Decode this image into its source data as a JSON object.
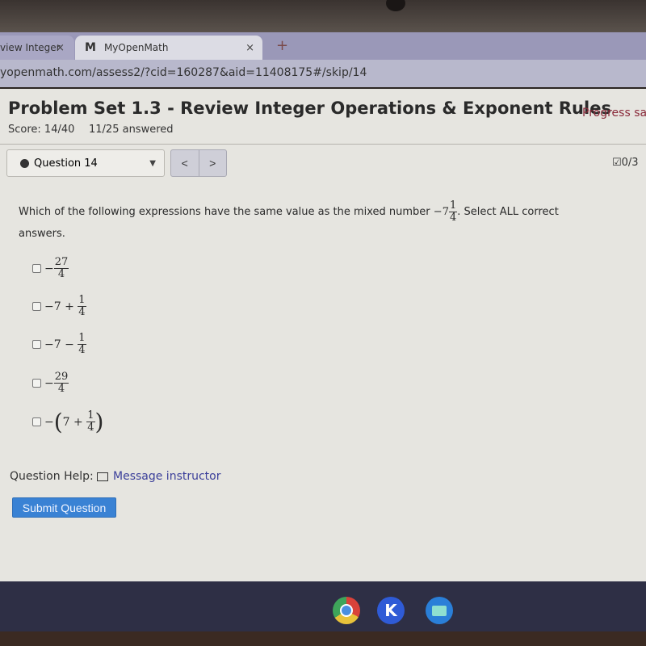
{
  "browser": {
    "tabs": [
      {
        "label": "view Integer",
        "active": false
      },
      {
        "label": "MyOpenMath",
        "active": true
      }
    ],
    "tab_close": "×",
    "new_tab": "+",
    "url": "yopenmath.com/assess2/?cid=160287&aid=11408175#/skip/14"
  },
  "header": {
    "title": "Problem Set 1.3 - Review Integer Operations & Exponent Rules",
    "progress_status": "Progress sav",
    "score": "Score: 14/40",
    "answered": "11/25 answered"
  },
  "nav": {
    "question_select": "Question 14",
    "prev": "<",
    "next": ">",
    "points": "0/3"
  },
  "question": {
    "text_before": "Which of the following expressions have the same value as the mixed number",
    "mixed_number": {
      "sign": "−",
      "whole": "7",
      "numerator": "1",
      "denominator": "4"
    },
    "text_after": ". Select ALL correct answers.",
    "options": [
      {
        "prefix": "−",
        "numerator": "27",
        "denominator": "4",
        "checked": false
      },
      {
        "prefix": "−7 +",
        "numerator": "1",
        "denominator": "4",
        "checked": false
      },
      {
        "prefix": "−7 −",
        "numerator": "1",
        "denominator": "4",
        "checked": false
      },
      {
        "prefix": "−",
        "numerator": "29",
        "denominator": "4",
        "checked": false
      },
      {
        "prefix": "−",
        "inner": "7 +",
        "numerator": "1",
        "denominator": "4",
        "checked": false
      }
    ]
  },
  "help": {
    "label": "Question Help:",
    "message_link": "Message instructor"
  },
  "submit_label": "Submit Question",
  "shelf": {
    "apps": [
      "chrome",
      "k-app",
      "files"
    ],
    "k_letter": "K"
  }
}
